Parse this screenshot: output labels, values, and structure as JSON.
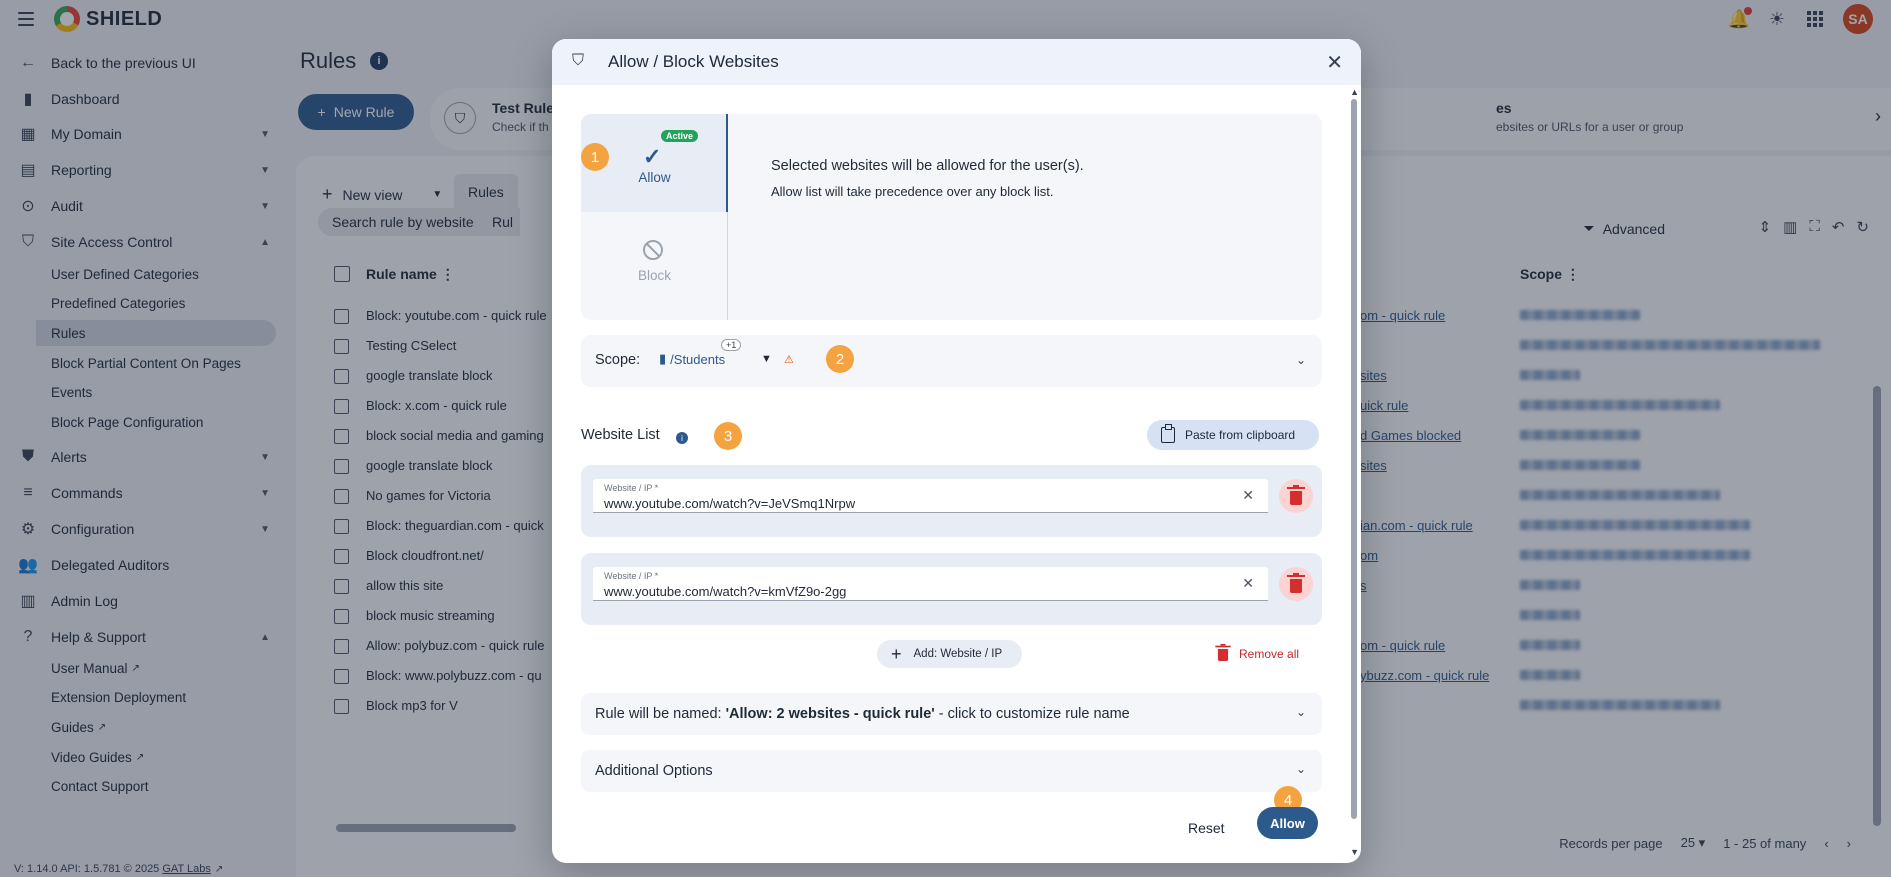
{
  "app": {
    "name": "SHIELD",
    "avatar_initials": "SA",
    "version_text": "V: 1.14.0  API: 1.5.781  © 2025",
    "company_link": "GAT Labs"
  },
  "sidebar": {
    "back": "Back to the previous UI",
    "items": [
      {
        "label": "Dashboard",
        "icon": "bar-chart-icon"
      },
      {
        "label": "My Domain",
        "icon": "building-icon"
      },
      {
        "label": "Reporting",
        "icon": "clipboard-icon"
      },
      {
        "label": "Audit",
        "icon": "search-shield-icon"
      },
      {
        "label": "Site Access Control",
        "icon": "shield-check-icon"
      },
      {
        "label": "Alerts",
        "icon": "alert-shield-icon"
      },
      {
        "label": "Commands",
        "icon": "commands-icon"
      },
      {
        "label": "Configuration",
        "icon": "gear-icon"
      },
      {
        "label": "Delegated Auditors",
        "icon": "people-icon"
      },
      {
        "label": "Admin Log",
        "icon": "book-icon"
      },
      {
        "label": "Help & Support",
        "icon": "help-icon"
      }
    ],
    "site_access_sub": [
      "User Defined Categories",
      "Predefined Categories",
      "Rules",
      "Block Partial Content On Pages",
      "Events",
      "Block Page Configuration"
    ],
    "help_sub": [
      "User Manual",
      "Extension Deployment",
      "Guides",
      "Video Guides",
      "Contact Support"
    ]
  },
  "main": {
    "title": "Rules",
    "new_rule": "New Rule",
    "banner_title": "Test Rules",
    "banner_sub": "Check if th",
    "banner_title2": "es",
    "banner_sub2": "ebsites or URLs for a user or group",
    "new_view": "New view",
    "tab": "Rules",
    "search_chip": "Search rule by website",
    "rule_chip": "Rul",
    "advanced": "Advanced",
    "col_rule_name": "Rule name",
    "col_scope": "Scope",
    "rows": [
      {
        "name": "Block: youtube.com - quick rule",
        "link": "om - quick rule"
      },
      {
        "name": "Testing CSelect",
        "link": ""
      },
      {
        "name": "google translate block",
        "link": "sites"
      },
      {
        "name": "Block: x.com - quick rule",
        "link": "uick rule"
      },
      {
        "name": "block social media and gaming",
        "link": "d Games blocked"
      },
      {
        "name": "google translate block",
        "link": "sites"
      },
      {
        "name": "No games for Victoria",
        "link": ""
      },
      {
        "name": "Block: theguardian.com - quick",
        "link": "ian.com - quick rule"
      },
      {
        "name": "Block cloudfront.net/",
        "link": "om"
      },
      {
        "name": "allow this site",
        "link": "s"
      },
      {
        "name": "block music streaming",
        "link": ""
      },
      {
        "name": "Allow: polybuz.com - quick rule",
        "link": "om - quick rule"
      },
      {
        "name": "Block: www.polybuzz.com - qu",
        "link": "ybuzz.com - quick rule"
      },
      {
        "name": "Block mp3 for V",
        "link": ""
      }
    ],
    "records_per_page_label": "Records per page",
    "records_per_page": "25",
    "range": "1 - 25 of many"
  },
  "modal": {
    "title": "Allow / Block Websites",
    "active_badge": "Active",
    "allow_label": "Allow",
    "block_label": "Block",
    "allow_text1": "Selected websites will be allowed for the user(s).",
    "allow_text2": "Allow list will take precedence over any block list.",
    "scope_label": "Scope:",
    "scope_value": "/Students",
    "scope_plus": "+1",
    "website_list_title": "Website List",
    "paste_label": "Paste from clipboard",
    "entries": [
      {
        "label": "Website / IP *",
        "value": "www.youtube.com/watch?v=JeVSmq1Nrpw"
      },
      {
        "label": "Website / IP *",
        "value": "www.youtube.com/watch?v=kmVfZ9o-2gg"
      }
    ],
    "add_label": "Add: Website / IP",
    "remove_all": "Remove all",
    "rule_name_prefix": "Rule will be named: ",
    "rule_name": "'Allow: 2 websites - quick rule'",
    "rule_name_suffix": " - click to customize rule name",
    "additional_options": "Additional Options",
    "reset": "Reset",
    "submit": "Allow",
    "steps": [
      "1",
      "2",
      "3",
      "4"
    ]
  }
}
